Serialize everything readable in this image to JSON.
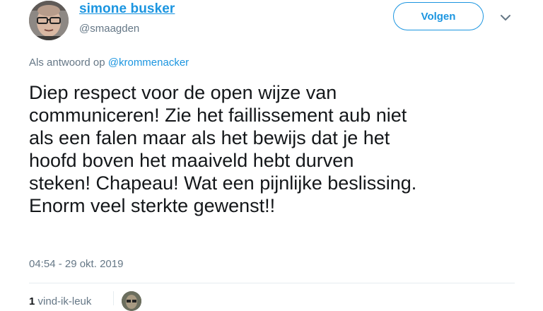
{
  "author": {
    "display_name": "simone busker",
    "handle": "@smaagden"
  },
  "follow_button": {
    "label": "Volgen"
  },
  "icons": {
    "more": "chevron-down-icon",
    "avatar": "user-avatar"
  },
  "reply_context": {
    "prefix": "Als antwoord op",
    "mention": "@krommenacker"
  },
  "tweet": {
    "lines": [
      "Diep respect voor de open wijze van",
      "communiceren! Zie het faillissement aub niet",
      "als een falen maar als het bewijs dat je het",
      "hoofd boven het maaiveld hebt durven",
      "steken! Chapeau! Wat een pijnlijke beslissing.",
      "Enorm veel sterkte gewenst!!"
    ],
    "timestamp": "04:54 - 29 okt. 2019"
  },
  "stats": {
    "like_count": "1",
    "like_label": "vind-ik-leuk"
  },
  "colors": {
    "link": "#1b95e0",
    "secondary_text": "#657786",
    "primary_text": "#14171a",
    "divider": "#e6ecf0"
  }
}
